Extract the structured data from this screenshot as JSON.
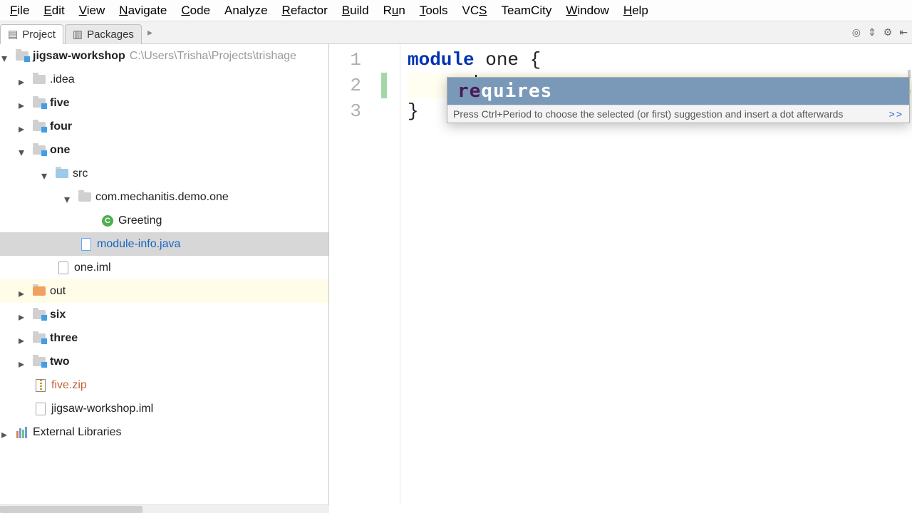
{
  "menu": [
    "File",
    "Edit",
    "View",
    "Navigate",
    "Code",
    "Analyze",
    "Refactor",
    "Build",
    "Run",
    "Tools",
    "VCS",
    "TeamCity",
    "Window",
    "Help"
  ],
  "tabs": {
    "project": "Project",
    "packages": "Packages"
  },
  "tree": {
    "root": {
      "name": "jigsaw-workshop",
      "path": "C:\\Users\\Trisha\\Projects\\trishage"
    },
    "idea": ".idea",
    "five": "five",
    "four": "four",
    "one": "one",
    "src": "src",
    "pkg": "com.mechanitis.demo.one",
    "greeting": "Greeting",
    "moduleinfo": "module-info.java",
    "oneiml": "one.iml",
    "out": "out",
    "six": "six",
    "three": "three",
    "two": "two",
    "fivezip": "five.zip",
    "wsiml": "jigsaw-workshop.iml",
    "extlib": "External Libraries"
  },
  "editor": {
    "lines": [
      "1",
      "2",
      "3"
    ],
    "code": {
      "l1_kw": "module",
      "l1_rest": " one {",
      "l2_indent": "    ",
      "l2_text": "re",
      "l3": "}"
    }
  },
  "completion": {
    "match": "re",
    "rest": "quires",
    "hint": "Press Ctrl+Period to choose the selected (or first) suggestion and insert a dot afterwards",
    "more": ">>"
  }
}
